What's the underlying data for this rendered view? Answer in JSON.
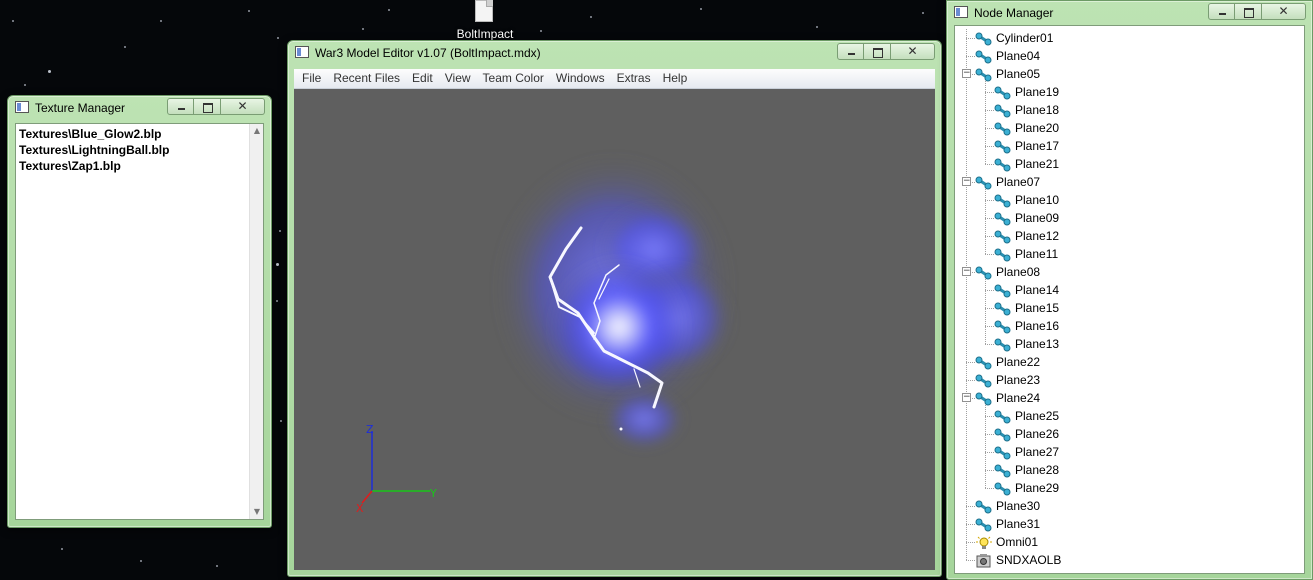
{
  "desktop": {
    "file_label": "BoltImpact"
  },
  "texture_manager": {
    "title": "Texture Manager",
    "items": [
      "Textures\\Blue_Glow2.blp",
      "Textures\\LightningBall.blp",
      "Textures\\Zap1.blp"
    ]
  },
  "editor": {
    "title": "War3 Model Editor v1.07 (BoltImpact.mdx)",
    "menu": [
      "File",
      "Recent Files",
      "Edit",
      "View",
      "Team Color",
      "Windows",
      "Extras",
      "Help"
    ],
    "axes": {
      "z": "Z",
      "y": "Y",
      "x": "X"
    },
    "colors": {
      "viewport_bg": "#5f5f5f",
      "glow": "#5a5cff",
      "axis_z": "#1f2fd8",
      "axis_y": "#19c619",
      "axis_x": "#e21b1b"
    }
  },
  "node_manager": {
    "title": "Node Manager",
    "nodes": [
      {
        "label": "Cylinder01",
        "depth": 0,
        "icon": "bone-icon"
      },
      {
        "label": "Plane04",
        "depth": 0,
        "icon": "bone-icon"
      },
      {
        "label": "Plane05",
        "depth": 0,
        "icon": "bone-icon",
        "expanded": true
      },
      {
        "label": "Plane19",
        "depth": 1,
        "icon": "bone-icon"
      },
      {
        "label": "Plane18",
        "depth": 1,
        "icon": "bone-icon"
      },
      {
        "label": "Plane20",
        "depth": 1,
        "icon": "bone-icon"
      },
      {
        "label": "Plane17",
        "depth": 1,
        "icon": "bone-icon"
      },
      {
        "label": "Plane21",
        "depth": 1,
        "icon": "bone-icon"
      },
      {
        "label": "Plane07",
        "depth": 0,
        "icon": "bone-icon",
        "expanded": true
      },
      {
        "label": "Plane10",
        "depth": 1,
        "icon": "bone-icon"
      },
      {
        "label": "Plane09",
        "depth": 1,
        "icon": "bone-icon"
      },
      {
        "label": "Plane12",
        "depth": 1,
        "icon": "bone-icon"
      },
      {
        "label": "Plane11",
        "depth": 1,
        "icon": "bone-icon"
      },
      {
        "label": "Plane08",
        "depth": 0,
        "icon": "bone-icon",
        "expanded": true
      },
      {
        "label": "Plane14",
        "depth": 1,
        "icon": "bone-icon"
      },
      {
        "label": "Plane15",
        "depth": 1,
        "icon": "bone-icon"
      },
      {
        "label": "Plane16",
        "depth": 1,
        "icon": "bone-icon"
      },
      {
        "label": "Plane13",
        "depth": 1,
        "icon": "bone-icon"
      },
      {
        "label": "Plane22",
        "depth": 0,
        "icon": "bone-icon"
      },
      {
        "label": "Plane23",
        "depth": 0,
        "icon": "bone-icon"
      },
      {
        "label": "Plane24",
        "depth": 0,
        "icon": "bone-icon",
        "expanded": true
      },
      {
        "label": "Plane25",
        "depth": 1,
        "icon": "bone-icon"
      },
      {
        "label": "Plane26",
        "depth": 1,
        "icon": "bone-icon"
      },
      {
        "label": "Plane27",
        "depth": 1,
        "icon": "bone-icon"
      },
      {
        "label": "Plane28",
        "depth": 1,
        "icon": "bone-icon"
      },
      {
        "label": "Plane29",
        "depth": 1,
        "icon": "bone-icon"
      },
      {
        "label": "Plane30",
        "depth": 0,
        "icon": "bone-icon"
      },
      {
        "label": "Plane31",
        "depth": 0,
        "icon": "bone-icon"
      },
      {
        "label": "Omni01",
        "depth": 0,
        "icon": "light-bulb-icon"
      },
      {
        "label": "SNDXAOLB",
        "depth": 0,
        "icon": "sound-icon"
      }
    ]
  }
}
